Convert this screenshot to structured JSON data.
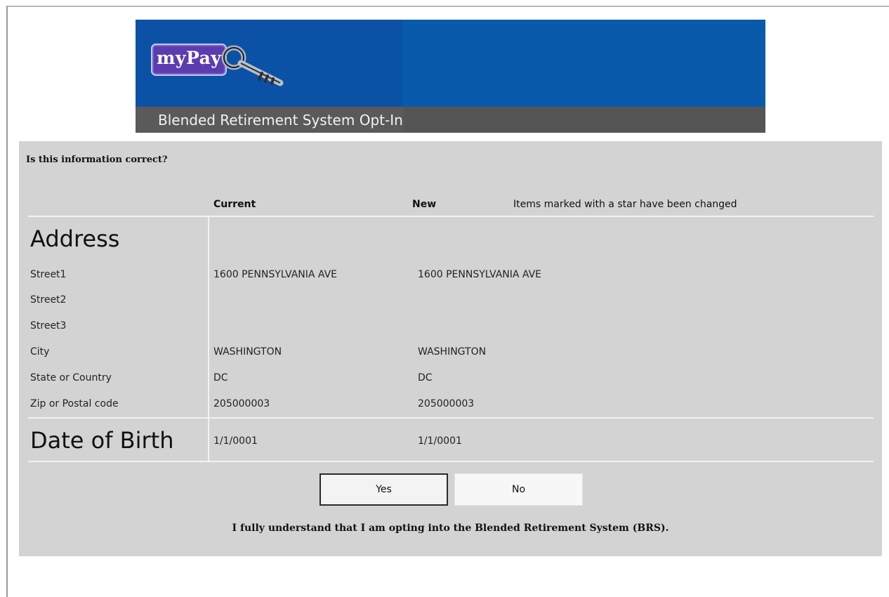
{
  "header": {
    "logo_text": "myPay",
    "subtitle": "Blended Retirement System Opt-In"
  },
  "form": {
    "question": "Is this information correct?",
    "columns": {
      "current": "Current",
      "new": "New",
      "note": "Items marked with a star have been changed"
    },
    "address": {
      "title": "Address",
      "rows": [
        {
          "label": "Street1",
          "current": "1600 PENNSYLVANIA AVE",
          "new": "1600 PENNSYLVANIA AVE"
        },
        {
          "label": "Street2",
          "current": "",
          "new": ""
        },
        {
          "label": "Street3",
          "current": "",
          "new": ""
        },
        {
          "label": "City",
          "current": "WASHINGTON",
          "new": "WASHINGTON"
        },
        {
          "label": "State or Country",
          "current": "DC",
          "new": "DC"
        },
        {
          "label": "Zip or Postal code",
          "current": "205000003",
          "new": "205000003"
        }
      ]
    },
    "dob": {
      "title": "Date of Birth",
      "current": "1/1/0001",
      "new": "1/1/0001"
    },
    "buttons": {
      "yes": "Yes",
      "no": "No"
    },
    "confirmation": "I fully understand that I am opting into the Blended Retirement System (BRS)."
  },
  "colors": {
    "banner": "#0b52a6",
    "subtitle_bar": "#555555",
    "panel": "#d3d3d3"
  }
}
